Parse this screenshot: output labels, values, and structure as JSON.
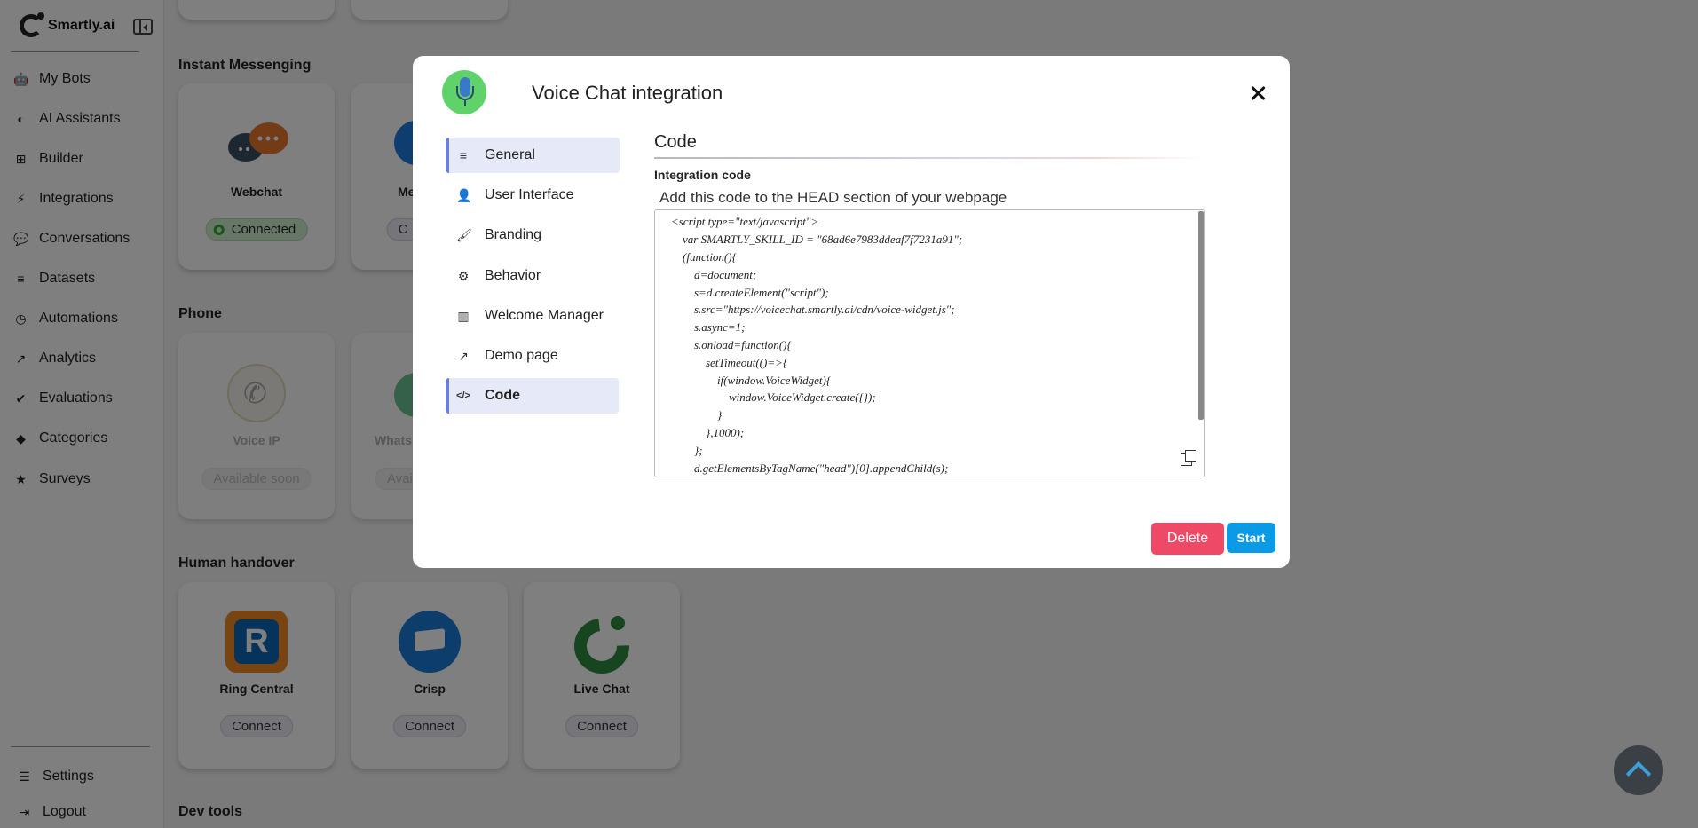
{
  "app": {
    "name": "Smartly.ai"
  },
  "sidebar": {
    "items": [
      {
        "label": "My Bots",
        "icon": "robot-icon",
        "glyph": "🤖"
      },
      {
        "label": "AI Assistants",
        "icon": "brain-icon",
        "glyph": "◐"
      },
      {
        "label": "Builder",
        "icon": "sitemap-icon",
        "glyph": "⊞"
      },
      {
        "label": "Integrations",
        "icon": "plug-icon",
        "glyph": "⚡"
      },
      {
        "label": "Conversations",
        "icon": "comments-icon",
        "glyph": "💬"
      },
      {
        "label": "Datasets",
        "icon": "database-icon",
        "glyph": "≡"
      },
      {
        "label": "Automations",
        "icon": "clock-icon",
        "glyph": "◷"
      },
      {
        "label": "Analytics",
        "icon": "chart-line-icon",
        "glyph": "↗"
      },
      {
        "label": "Evaluations",
        "icon": "check-circle-icon",
        "glyph": "✔"
      },
      {
        "label": "Categories",
        "icon": "tags-icon",
        "glyph": "◆"
      },
      {
        "label": "Surveys",
        "icon": "star-icon",
        "glyph": "★"
      }
    ],
    "bottom": [
      {
        "label": "Settings",
        "icon": "sliders-icon",
        "glyph": "☰"
      },
      {
        "label": "Logout",
        "icon": "logout-icon",
        "glyph": "⇥"
      }
    ]
  },
  "sections": {
    "instant_messaging": "Instant Messenging",
    "phone": "Phone",
    "human_handover": "Human handover",
    "dev_tools": "Dev tools"
  },
  "cards": {
    "webchat": {
      "name": "Webchat",
      "status": "Connected"
    },
    "messenger_partial": {
      "name": "Me",
      "status": "C"
    },
    "voice_ip": {
      "name": "Voice IP",
      "status": "Available soon"
    },
    "whatsapp_partial": {
      "name": "Whats",
      "status": "Avail"
    },
    "ring_central": {
      "name": "Ring Central",
      "status": "Connect"
    },
    "crisp": {
      "name": "Crisp",
      "status": "Connect"
    },
    "live_chat": {
      "name": "Live Chat",
      "status": "Connect"
    }
  },
  "modal": {
    "title": "Voice Chat integration",
    "menu": [
      {
        "label": "General",
        "icon": "bars-icon",
        "glyph": "≡"
      },
      {
        "label": "User Interface",
        "icon": "user-icon",
        "glyph": "👤"
      },
      {
        "label": "Branding",
        "icon": "brush-icon",
        "glyph": "🖌"
      },
      {
        "label": "Behavior",
        "icon": "cogs-icon",
        "glyph": "⚙"
      },
      {
        "label": "Welcome Manager",
        "icon": "bar-chart-icon",
        "glyph": "▥"
      },
      {
        "label": "Demo page",
        "icon": "external-link-icon",
        "glyph": "↗"
      },
      {
        "label": "Code",
        "icon": "code-icon",
        "glyph": "</>"
      }
    ],
    "content": {
      "title": "Code",
      "field_label": "Integration code",
      "hint": "Add this code to the HEAD section of your webpage",
      "code_lines": [
        "<script type=\"text/javascript\">",
        "    var SMARTLY_SKILL_ID = \"68ad6e7983ddeaf7f7231a91\";",
        "    (function(){",
        "        d=document;",
        "        s=d.createElement(\"script\");",
        "        s.src=\"https://voicechat.smartly.ai/cdn/voice-widget.js\";",
        "        s.async=1;",
        "        s.onload=function(){",
        "            setTimeout(()=>{",
        "                if(window.VoiceWidget){",
        "                    window.VoiceWidget.create({});",
        "                }",
        "            },1000);",
        "        };",
        "        d.getElementsByTagName(\"head\")[0].appendChild(s);"
      ]
    },
    "buttons": {
      "delete": "Delete",
      "start": "Start"
    }
  }
}
